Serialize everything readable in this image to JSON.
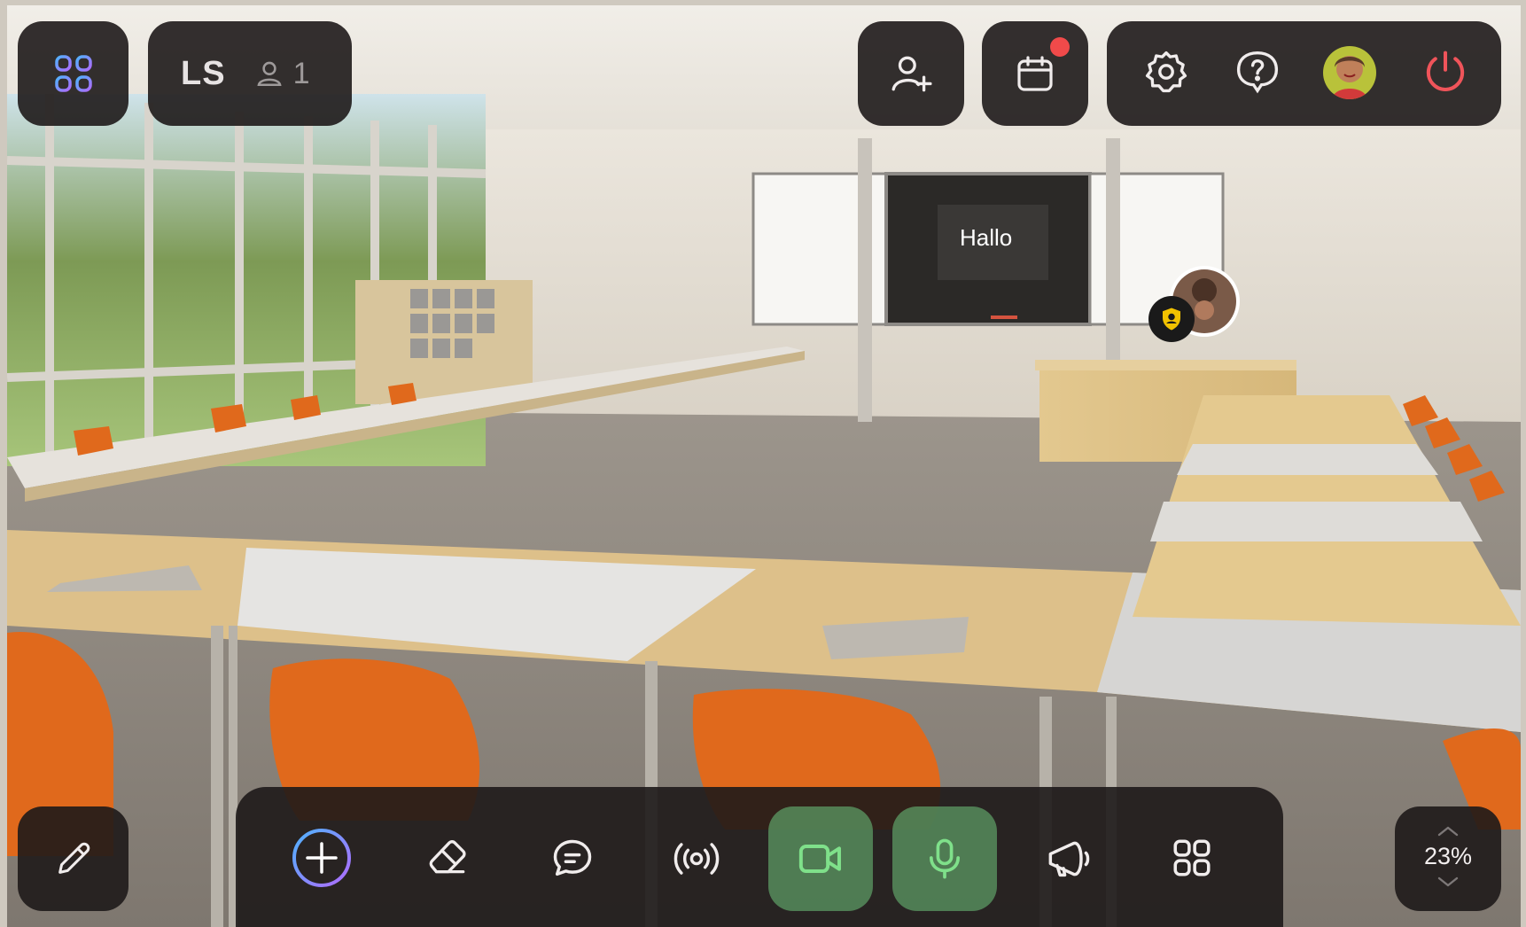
{
  "room": {
    "code": "LS",
    "participant_count": "1"
  },
  "board": {
    "text": "Hallo"
  },
  "zoom": {
    "value": "23%"
  },
  "notifications": {
    "calendar_has_badge": true
  },
  "icons": {
    "apps": "apps-grid-icon",
    "users": "user-icon",
    "invite": "user-plus-icon",
    "calendar": "calendar-icon",
    "settings": "gear-icon",
    "help": "help-icon",
    "power": "power-icon",
    "pencil": "pencil-icon",
    "add": "plus-circle-icon",
    "eraser": "eraser-icon",
    "chat": "chat-icon",
    "broadcast": "broadcast-icon",
    "camera": "video-camera-icon",
    "mic": "microphone-icon",
    "megaphone": "megaphone-icon",
    "grid": "grid-icon",
    "zoom_up": "chevron-up-icon",
    "zoom_down": "chevron-down-icon",
    "moderator": "moderator-badge-icon"
  },
  "colors": {
    "panel": "#1e1a1a",
    "accent_green": "#7fe08a",
    "active_green_bg": "#4e8a56",
    "badge_red": "#f04a4a",
    "gradient_a": "#4fb3ff",
    "gradient_b": "#b06bff"
  }
}
